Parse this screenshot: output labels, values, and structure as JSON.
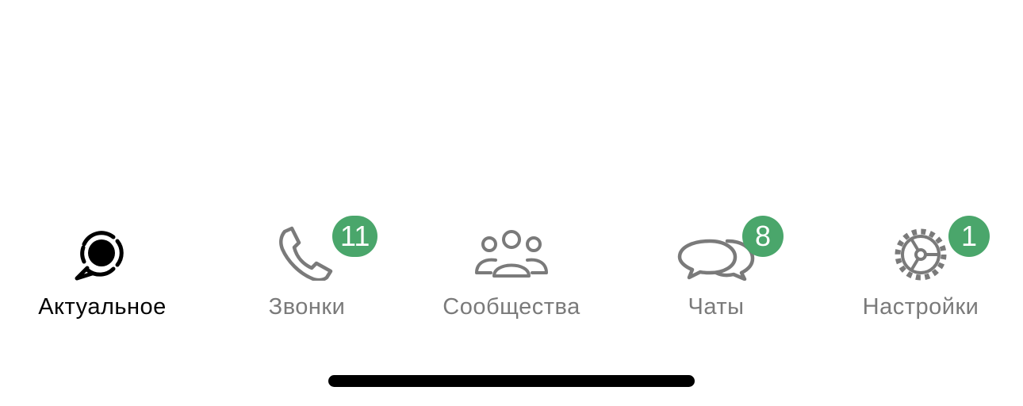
{
  "colors": {
    "active": "#000000",
    "inactive": "#7a7a7a",
    "badge": "#4aa66b",
    "home_indicator": "#000000"
  },
  "tabs": [
    {
      "label": "Актуальное",
      "icon": "status-bubble-icon",
      "active": true,
      "badge": null
    },
    {
      "label": "Звонки",
      "icon": "phone-icon",
      "active": false,
      "badge": "11"
    },
    {
      "label": "Сообщества",
      "icon": "communities-icon",
      "active": false,
      "badge": null
    },
    {
      "label": "Чаты",
      "icon": "chats-icon",
      "active": false,
      "badge": "8"
    },
    {
      "label": "Настройки",
      "icon": "settings-gear-icon",
      "active": false,
      "badge": "1"
    }
  ]
}
